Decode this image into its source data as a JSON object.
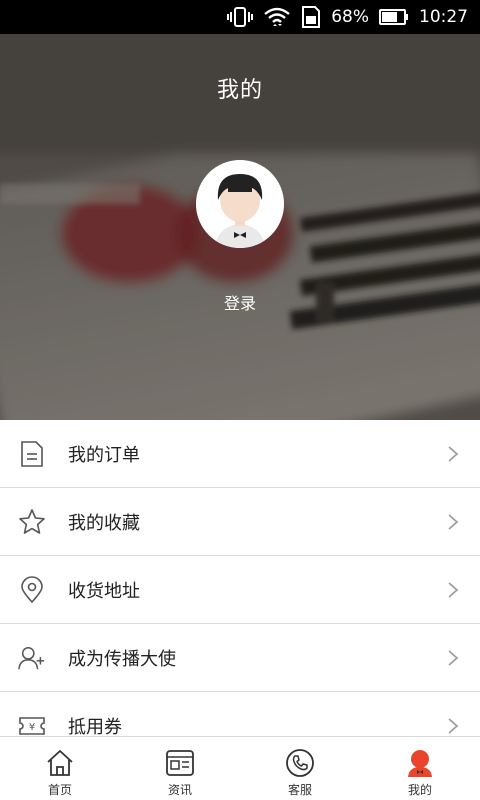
{
  "status_bar": {
    "battery": "68%",
    "time": "10:27"
  },
  "header": {
    "title": "我的",
    "login": "登录"
  },
  "menu": [
    {
      "label": "我的订单",
      "icon": "document-icon"
    },
    {
      "label": "我的收藏",
      "icon": "star-icon"
    },
    {
      "label": "收货地址",
      "icon": "location-pin-icon"
    },
    {
      "label": "成为传播大使",
      "icon": "add-user-icon"
    },
    {
      "label": "抵用券",
      "icon": "ticket-icon"
    }
  ],
  "bottom_nav": [
    {
      "label": "首页",
      "icon": "home-icon"
    },
    {
      "label": "资讯",
      "icon": "news-icon"
    },
    {
      "label": "客服",
      "icon": "phone-icon"
    },
    {
      "label": "我的",
      "icon": "profile-icon",
      "active": true
    }
  ],
  "colors": {
    "accent": "#e8452c",
    "header_bg": "#4f4a45",
    "menu_bg": "#ffffff"
  }
}
